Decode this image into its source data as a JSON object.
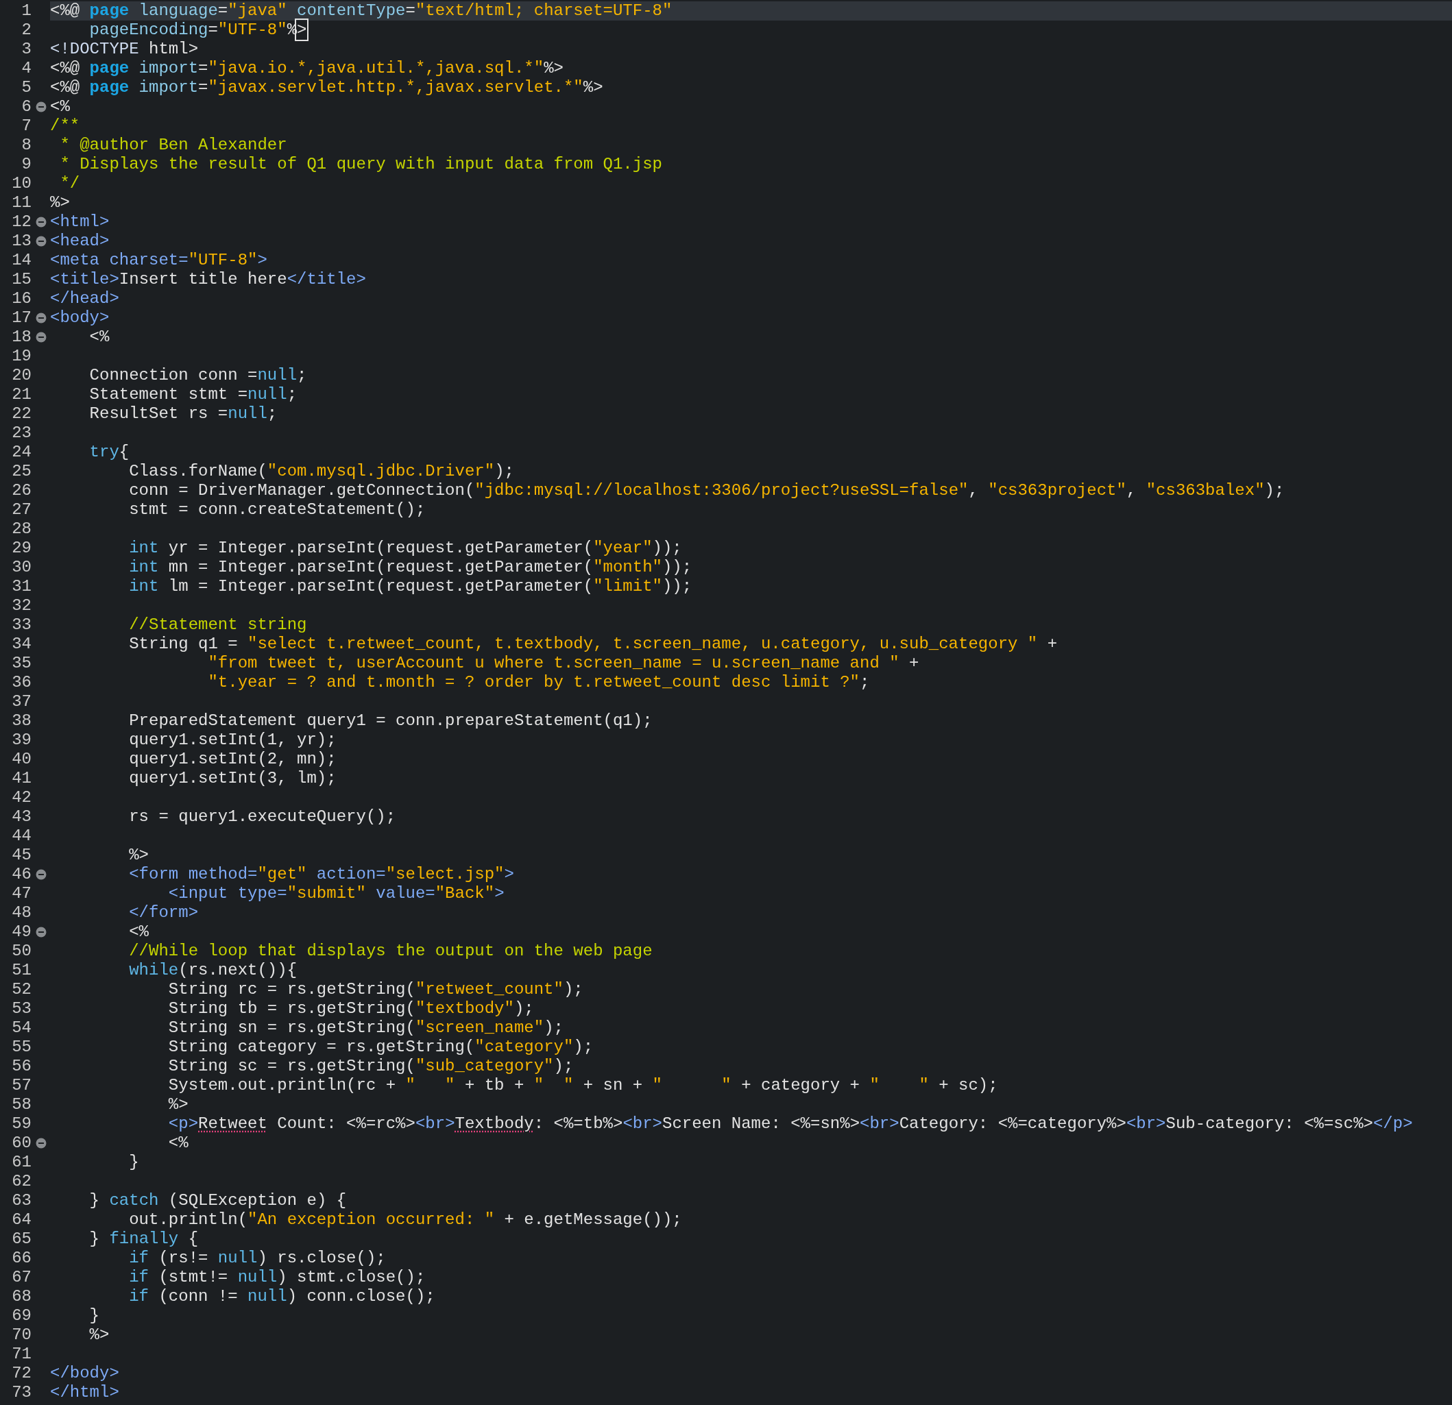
{
  "editor": {
    "lines": [
      {
        "number": "1",
        "fold": false,
        "current": true,
        "segments": [
          {
            "kind": "plain",
            "text": "<%@ "
          },
          {
            "kind": "keyword",
            "text": "page"
          },
          {
            "kind": "attribute",
            "text": " language"
          },
          {
            "kind": "plain",
            "text": "="
          },
          {
            "kind": "string",
            "text": "\"java\""
          },
          {
            "kind": "attribute",
            "text": " contentType"
          },
          {
            "kind": "plain",
            "text": "="
          },
          {
            "kind": "string",
            "text": "\"text/html; charset=UTF-8\""
          }
        ]
      },
      {
        "number": "2",
        "fold": false,
        "current": false,
        "segments": [
          {
            "kind": "attribute",
            "text": "    pageEncoding"
          },
          {
            "kind": "plain",
            "text": "="
          },
          {
            "kind": "string",
            "text": "\"UTF-8\""
          },
          {
            "kind": "plain",
            "text": "%"
          },
          {
            "kind": "cursor",
            "text": ">"
          }
        ]
      },
      {
        "number": "3",
        "fold": false,
        "current": false,
        "segments": [
          {
            "kind": "doctype",
            "text": "<!DOCTYPE"
          },
          {
            "kind": "plain",
            "text": " html>"
          }
        ]
      },
      {
        "number": "4",
        "fold": false,
        "current": false,
        "segments": [
          {
            "kind": "plain",
            "text": "<%@ "
          },
          {
            "kind": "keyword",
            "text": "page"
          },
          {
            "kind": "attribute",
            "text": " import"
          },
          {
            "kind": "plain",
            "text": "="
          },
          {
            "kind": "string",
            "text": "\"java.io.*,java.util.*,java.sql.*\""
          },
          {
            "kind": "plain",
            "text": "%>"
          }
        ]
      },
      {
        "number": "5",
        "fold": false,
        "current": false,
        "segments": [
          {
            "kind": "plain",
            "text": "<%@ "
          },
          {
            "kind": "keyword",
            "text": "page"
          },
          {
            "kind": "attribute",
            "text": " import"
          },
          {
            "kind": "plain",
            "text": "="
          },
          {
            "kind": "string",
            "text": "\"javax.servlet.http.*,javax.servlet.*\""
          },
          {
            "kind": "plain",
            "text": "%>"
          }
        ]
      },
      {
        "number": "6",
        "fold": true,
        "current": false,
        "segments": [
          {
            "kind": "plain",
            "text": "<%"
          }
        ]
      },
      {
        "number": "7",
        "fold": false,
        "current": false,
        "segments": [
          {
            "kind": "comment",
            "text": "/**"
          }
        ]
      },
      {
        "number": "8",
        "fold": false,
        "current": false,
        "segments": [
          {
            "kind": "comment",
            "text": " * @author Ben Alexander"
          }
        ]
      },
      {
        "number": "9",
        "fold": false,
        "current": false,
        "segments": [
          {
            "kind": "comment",
            "text": " * Displays the result of Q1 query with input data from Q1.jsp"
          }
        ]
      },
      {
        "number": "10",
        "fold": false,
        "current": false,
        "segments": [
          {
            "kind": "comment",
            "text": " */"
          }
        ]
      },
      {
        "number": "11",
        "fold": false,
        "current": false,
        "segments": [
          {
            "kind": "plain",
            "text": "%>"
          }
        ]
      },
      {
        "number": "12",
        "fold": true,
        "current": false,
        "segments": [
          {
            "kind": "tag",
            "text": "<html>"
          }
        ]
      },
      {
        "number": "13",
        "fold": true,
        "current": false,
        "segments": [
          {
            "kind": "tag",
            "text": "<head>"
          }
        ]
      },
      {
        "number": "14",
        "fold": false,
        "current": false,
        "segments": [
          {
            "kind": "tag",
            "text": "<meta charset="
          },
          {
            "kind": "string",
            "text": "\"UTF-8\""
          },
          {
            "kind": "tag",
            "text": ">"
          }
        ]
      },
      {
        "number": "15",
        "fold": false,
        "current": false,
        "segments": [
          {
            "kind": "tag",
            "text": "<title>"
          },
          {
            "kind": "plain",
            "text": "Insert title here"
          },
          {
            "kind": "tag",
            "text": "</title>"
          }
        ]
      },
      {
        "number": "16",
        "fold": false,
        "current": false,
        "segments": [
          {
            "kind": "tag",
            "text": "</head>"
          }
        ]
      },
      {
        "number": "17",
        "fold": true,
        "current": false,
        "segments": [
          {
            "kind": "tag",
            "text": "<body>"
          }
        ]
      },
      {
        "number": "18",
        "fold": true,
        "current": false,
        "segments": [
          {
            "kind": "plain",
            "text": "    <%"
          }
        ]
      },
      {
        "number": "19",
        "fold": false,
        "current": false
      },
      {
        "number": "20",
        "fold": false,
        "current": false,
        "segments": [
          {
            "kind": "plain",
            "text": "    Connection conn ="
          },
          {
            "kind": "reserved",
            "text": "null"
          },
          {
            "kind": "plain",
            "text": ";"
          }
        ]
      },
      {
        "number": "21",
        "fold": false,
        "current": false,
        "segments": [
          {
            "kind": "plain",
            "text": "    Statement stmt ="
          },
          {
            "kind": "reserved",
            "text": "null"
          },
          {
            "kind": "plain",
            "text": ";"
          }
        ]
      },
      {
        "number": "22",
        "fold": false,
        "current": false,
        "segments": [
          {
            "kind": "plain",
            "text": "    ResultSet rs ="
          },
          {
            "kind": "reserved",
            "text": "null"
          },
          {
            "kind": "plain",
            "text": ";"
          }
        ]
      },
      {
        "number": "23",
        "fold": false,
        "current": false
      },
      {
        "number": "24",
        "fold": false,
        "current": false,
        "segments": [
          {
            "kind": "reserved",
            "text": "    try"
          },
          {
            "kind": "plain",
            "text": "{"
          }
        ]
      },
      {
        "number": "25",
        "fold": false,
        "current": false,
        "segments": [
          {
            "kind": "plain",
            "text": "        Class.forName("
          },
          {
            "kind": "string",
            "text": "\"com.mysql.jdbc.Driver\""
          },
          {
            "kind": "plain",
            "text": ");"
          }
        ]
      },
      {
        "number": "26",
        "fold": false,
        "current": false,
        "segments": [
          {
            "kind": "plain",
            "text": "        conn = DriverManager.getConnection("
          },
          {
            "kind": "string",
            "text": "\"jdbc:mysql://localhost:3306/project?useSSL=false\""
          },
          {
            "kind": "plain",
            "text": ", "
          },
          {
            "kind": "string",
            "text": "\"cs363project\""
          },
          {
            "kind": "plain",
            "text": ", "
          },
          {
            "kind": "string",
            "text": "\"cs363balex\""
          },
          {
            "kind": "plain",
            "text": ");"
          }
        ]
      },
      {
        "number": "27",
        "fold": false,
        "current": false,
        "segments": [
          {
            "kind": "plain",
            "text": "        stmt = conn.createStatement();"
          }
        ]
      },
      {
        "number": "28",
        "fold": false,
        "current": false
      },
      {
        "number": "29",
        "fold": false,
        "current": false,
        "segments": [
          {
            "kind": "reserved",
            "text": "        int"
          },
          {
            "kind": "plain",
            "text": " yr = Integer.parseInt(request.getParameter("
          },
          {
            "kind": "string",
            "text": "\"year\""
          },
          {
            "kind": "plain",
            "text": "));"
          }
        ]
      },
      {
        "number": "30",
        "fold": false,
        "current": false,
        "segments": [
          {
            "kind": "reserved",
            "text": "        int"
          },
          {
            "kind": "plain",
            "text": " mn = Integer.parseInt(request.getParameter("
          },
          {
            "kind": "string",
            "text": "\"month\""
          },
          {
            "kind": "plain",
            "text": "));"
          }
        ]
      },
      {
        "number": "31",
        "fold": false,
        "current": false,
        "segments": [
          {
            "kind": "reserved",
            "text": "        int"
          },
          {
            "kind": "plain",
            "text": " lm = Integer.parseInt(request.getParameter("
          },
          {
            "kind": "string",
            "text": "\"limit\""
          },
          {
            "kind": "plain",
            "text": "));"
          }
        ]
      },
      {
        "number": "32",
        "fold": false,
        "current": false
      },
      {
        "number": "33",
        "fold": false,
        "current": false,
        "segments": [
          {
            "kind": "comment",
            "text": "        //Statement string"
          }
        ]
      },
      {
        "number": "34",
        "fold": false,
        "current": false,
        "segments": [
          {
            "kind": "plain",
            "text": "        String q1 = "
          },
          {
            "kind": "string",
            "text": "\"select t.retweet_count, t.textbody, t.screen_name, u.category, u.sub_category \""
          },
          {
            "kind": "plain",
            "text": " +"
          }
        ]
      },
      {
        "number": "35",
        "fold": false,
        "current": false,
        "segments": [
          {
            "kind": "string",
            "text": "                \"from tweet t, userAccount u where t.screen_name = u.screen_name and \""
          },
          {
            "kind": "plain",
            "text": " +"
          }
        ]
      },
      {
        "number": "36",
        "fold": false,
        "current": false,
        "segments": [
          {
            "kind": "string",
            "text": "                \"t.year = ? and t.month = ? order by t.retweet_count desc limit ?\""
          },
          {
            "kind": "plain",
            "text": ";"
          }
        ]
      },
      {
        "number": "37",
        "fold": false,
        "current": false
      },
      {
        "number": "38",
        "fold": false,
        "current": false,
        "segments": [
          {
            "kind": "plain",
            "text": "        PreparedStatement query1 = conn.prepareStatement(q1);"
          }
        ]
      },
      {
        "number": "39",
        "fold": false,
        "current": false,
        "segments": [
          {
            "kind": "plain",
            "text": "        query1.setInt(1, yr);"
          }
        ]
      },
      {
        "number": "40",
        "fold": false,
        "current": false,
        "segments": [
          {
            "kind": "plain",
            "text": "        query1.setInt(2, mn);"
          }
        ]
      },
      {
        "number": "41",
        "fold": false,
        "current": false,
        "segments": [
          {
            "kind": "plain",
            "text": "        query1.setInt(3, lm);"
          }
        ]
      },
      {
        "number": "42",
        "fold": false,
        "current": false
      },
      {
        "number": "43",
        "fold": false,
        "current": false,
        "segments": [
          {
            "kind": "plain",
            "text": "        rs = query1.executeQuery();"
          }
        ]
      },
      {
        "number": "44",
        "fold": false,
        "current": false
      },
      {
        "number": "45",
        "fold": false,
        "current": false,
        "segments": [
          {
            "kind": "plain",
            "text": "        %>"
          }
        ]
      },
      {
        "number": "46",
        "fold": true,
        "current": false,
        "segments": [
          {
            "kind": "tag",
            "text": "        <form method="
          },
          {
            "kind": "string",
            "text": "\"get\""
          },
          {
            "kind": "tag",
            "text": " action="
          },
          {
            "kind": "string",
            "text": "\"select.jsp\""
          },
          {
            "kind": "tag",
            "text": ">"
          }
        ]
      },
      {
        "number": "47",
        "fold": false,
        "current": false,
        "segments": [
          {
            "kind": "tag",
            "text": "            <input type="
          },
          {
            "kind": "string",
            "text": "\"submit\""
          },
          {
            "kind": "tag",
            "text": " value="
          },
          {
            "kind": "string",
            "text": "\"Back\""
          },
          {
            "kind": "tag",
            "text": ">"
          }
        ]
      },
      {
        "number": "48",
        "fold": false,
        "current": false,
        "segments": [
          {
            "kind": "tag",
            "text": "        </form>"
          }
        ]
      },
      {
        "number": "49",
        "fold": true,
        "current": false,
        "segments": [
          {
            "kind": "plain",
            "text": "        <%"
          }
        ]
      },
      {
        "number": "50",
        "fold": false,
        "current": false,
        "segments": [
          {
            "kind": "comment",
            "text": "        //While loop that displays the output on the web page"
          }
        ]
      },
      {
        "number": "51",
        "fold": false,
        "current": false,
        "segments": [
          {
            "kind": "reserved",
            "text": "        while"
          },
          {
            "kind": "plain",
            "text": "(rs.next()){"
          }
        ]
      },
      {
        "number": "52",
        "fold": false,
        "current": false,
        "segments": [
          {
            "kind": "plain",
            "text": "            String rc = rs.getString("
          },
          {
            "kind": "string",
            "text": "\"retweet_count\""
          },
          {
            "kind": "plain",
            "text": ");"
          }
        ]
      },
      {
        "number": "53",
        "fold": false,
        "current": false,
        "segments": [
          {
            "kind": "plain",
            "text": "            String tb = rs.getString("
          },
          {
            "kind": "string",
            "text": "\"textbody\""
          },
          {
            "kind": "plain",
            "text": ");"
          }
        ]
      },
      {
        "number": "54",
        "fold": false,
        "current": false,
        "segments": [
          {
            "kind": "plain",
            "text": "            String sn = rs.getString("
          },
          {
            "kind": "string",
            "text": "\"screen_name\""
          },
          {
            "kind": "plain",
            "text": ");"
          }
        ]
      },
      {
        "number": "55",
        "fold": false,
        "current": false,
        "segments": [
          {
            "kind": "plain",
            "text": "            String category = rs.getString("
          },
          {
            "kind": "string",
            "text": "\"category\""
          },
          {
            "kind": "plain",
            "text": ");"
          }
        ]
      },
      {
        "number": "56",
        "fold": false,
        "current": false,
        "segments": [
          {
            "kind": "plain",
            "text": "            String sc = rs.getString("
          },
          {
            "kind": "string",
            "text": "\"sub_category\""
          },
          {
            "kind": "plain",
            "text": ");"
          }
        ]
      },
      {
        "number": "57",
        "fold": false,
        "current": false,
        "segments": [
          {
            "kind": "plain",
            "text": "            System.out.println(rc + "
          },
          {
            "kind": "string",
            "text": "\"   \""
          },
          {
            "kind": "plain",
            "text": " + tb + "
          },
          {
            "kind": "string",
            "text": "\"  \""
          },
          {
            "kind": "plain",
            "text": " + sn + "
          },
          {
            "kind": "string",
            "text": "\"      \""
          },
          {
            "kind": "plain",
            "text": " + category + "
          },
          {
            "kind": "string",
            "text": "\"    \""
          },
          {
            "kind": "plain",
            "text": " + sc);"
          }
        ]
      },
      {
        "number": "58",
        "fold": false,
        "current": false,
        "segments": [
          {
            "kind": "plain",
            "text": "            %>"
          }
        ]
      },
      {
        "number": "59",
        "fold": false,
        "current": false,
        "segments": [
          {
            "kind": "tag",
            "text": "            <p>"
          },
          {
            "kind": "misspelled",
            "text": "Retweet"
          },
          {
            "kind": "plain",
            "text": " Count: <%=rc%>"
          },
          {
            "kind": "tag",
            "text": "<br>"
          },
          {
            "kind": "misspelled",
            "text": "Textbody"
          },
          {
            "kind": "plain",
            "text": ": <%=tb%>"
          },
          {
            "kind": "tag",
            "text": "<br>"
          },
          {
            "kind": "plain",
            "text": "Screen Name: <%=sn%>"
          },
          {
            "kind": "tag",
            "text": "<br>"
          },
          {
            "kind": "plain",
            "text": "Category: <%=category%>"
          },
          {
            "kind": "tag",
            "text": "<br>"
          },
          {
            "kind": "plain",
            "text": "Sub-category: <%=sc%>"
          },
          {
            "kind": "tag",
            "text": "</p>"
          }
        ]
      },
      {
        "number": "60",
        "fold": true,
        "current": false,
        "segments": [
          {
            "kind": "plain",
            "text": "            <%"
          }
        ]
      },
      {
        "number": "61",
        "fold": false,
        "current": false,
        "segments": [
          {
            "kind": "plain",
            "text": "        }"
          }
        ]
      },
      {
        "number": "62",
        "fold": false,
        "current": false
      },
      {
        "number": "63",
        "fold": false,
        "current": false,
        "segments": [
          {
            "kind": "plain",
            "text": "    } "
          },
          {
            "kind": "reserved",
            "text": "catch"
          },
          {
            "kind": "plain",
            "text": " (SQLException e) {"
          }
        ]
      },
      {
        "number": "64",
        "fold": false,
        "current": false,
        "segments": [
          {
            "kind": "plain",
            "text": "        out.println("
          },
          {
            "kind": "string",
            "text": "\"An exception occurred: \""
          },
          {
            "kind": "plain",
            "text": " + e.getMessage());"
          }
        ]
      },
      {
        "number": "65",
        "fold": false,
        "current": false,
        "segments": [
          {
            "kind": "plain",
            "text": "    } "
          },
          {
            "kind": "reserved",
            "text": "finally"
          },
          {
            "kind": "plain",
            "text": " {"
          }
        ]
      },
      {
        "number": "66",
        "fold": false,
        "current": false,
        "segments": [
          {
            "kind": "reserved",
            "text": "        if"
          },
          {
            "kind": "plain",
            "text": " (rs!= "
          },
          {
            "kind": "reserved",
            "text": "null"
          },
          {
            "kind": "plain",
            "text": ") rs.close();"
          }
        ]
      },
      {
        "number": "67",
        "fold": false,
        "current": false,
        "segments": [
          {
            "kind": "reserved",
            "text": "        if"
          },
          {
            "kind": "plain",
            "text": " (stmt!= "
          },
          {
            "kind": "reserved",
            "text": "null"
          },
          {
            "kind": "plain",
            "text": ") stmt.close();"
          }
        ]
      },
      {
        "number": "68",
        "fold": false,
        "current": false,
        "segments": [
          {
            "kind": "reserved",
            "text": "        if"
          },
          {
            "kind": "plain",
            "text": " (conn != "
          },
          {
            "kind": "reserved",
            "text": "null"
          },
          {
            "kind": "plain",
            "text": ") conn.close();"
          }
        ]
      },
      {
        "number": "69",
        "fold": false,
        "current": false,
        "segments": [
          {
            "kind": "plain",
            "text": "    }"
          }
        ]
      },
      {
        "number": "70",
        "fold": false,
        "current": false,
        "segments": [
          {
            "kind": "plain",
            "text": "    %>"
          }
        ]
      },
      {
        "number": "71",
        "fold": false,
        "current": false
      },
      {
        "number": "72",
        "fold": false,
        "current": false,
        "segments": [
          {
            "kind": "tag",
            "text": "</body>"
          }
        ]
      },
      {
        "number": "73",
        "fold": false,
        "current": false,
        "segments": [
          {
            "kind": "tag",
            "text": "</html>"
          }
        ]
      }
    ]
  }
}
